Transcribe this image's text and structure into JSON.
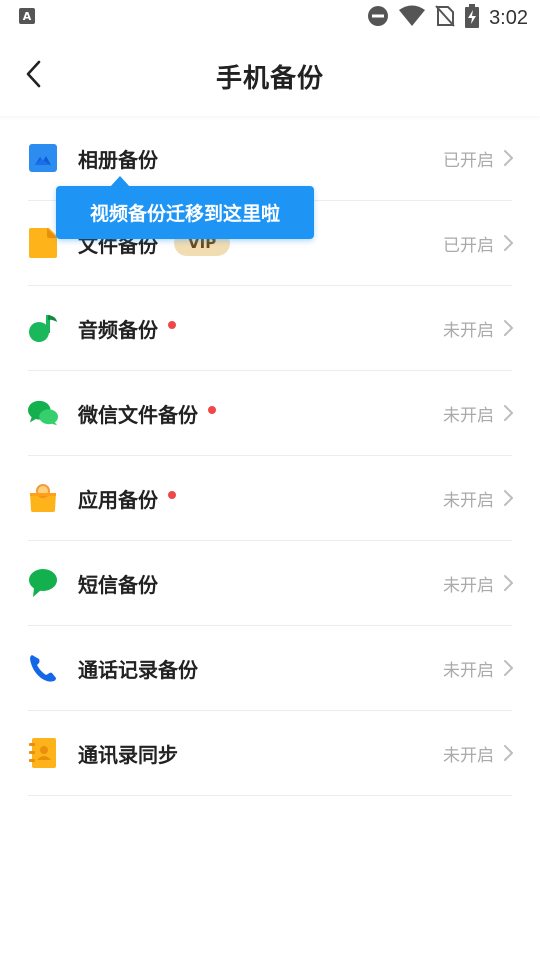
{
  "status_bar": {
    "time": "3:02",
    "icons": [
      "keyboard-a-icon",
      "do-not-disturb-icon",
      "wifi-icon",
      "no-sim-icon",
      "battery-charging-icon"
    ]
  },
  "app_bar": {
    "title": "手机备份",
    "back_icon": "chevron-left-icon"
  },
  "tooltip": {
    "text": "视频备份迁移到这里啦"
  },
  "items": [
    {
      "label": "相册备份",
      "status": "已开启",
      "icon": "photo-album-icon",
      "vip": "",
      "dot": false
    },
    {
      "label": "文件备份",
      "status": "已开启",
      "icon": "file-icon",
      "vip": "VIP",
      "dot": false
    },
    {
      "label": "音频备份",
      "status": "未开启",
      "icon": "music-note-icon",
      "vip": "",
      "dot": true
    },
    {
      "label": "微信文件备份",
      "status": "未开启",
      "icon": "wechat-icon",
      "vip": "",
      "dot": true
    },
    {
      "label": "应用备份",
      "status": "未开启",
      "icon": "app-bag-icon",
      "vip": "",
      "dot": true
    },
    {
      "label": "短信备份",
      "status": "未开启",
      "icon": "sms-bubble-icon",
      "vip": "",
      "dot": false
    },
    {
      "label": "通话记录备份",
      "status": "未开启",
      "icon": "phone-icon",
      "vip": "",
      "dot": false
    },
    {
      "label": "通讯录同步",
      "status": "未开启",
      "icon": "contacts-book-icon",
      "vip": "",
      "dot": false
    }
  ],
  "colors": {
    "accent_blue": "#1e94f5",
    "red_dot": "#f04848",
    "vip_bg": "#f2dcb2",
    "status_gray": "#aaaaaa"
  }
}
